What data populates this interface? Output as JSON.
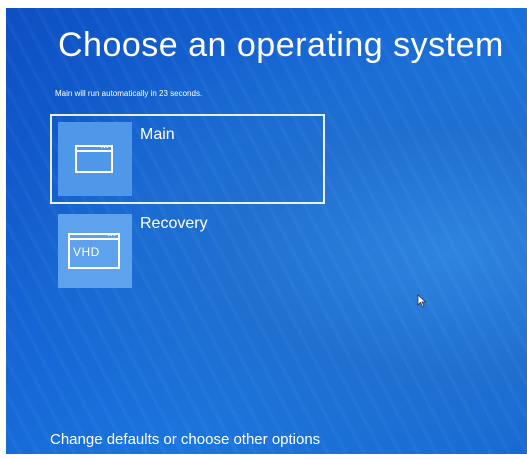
{
  "screen": {
    "title": "Choose an operating system",
    "countdown_text": "Main will run automatically in 23 seconds.",
    "footer_link": "Change defaults or choose other options"
  },
  "os_options": [
    {
      "name": "Main",
      "icon": "window-icon",
      "selected": true
    },
    {
      "name": "Recovery",
      "icon": "vhd-window-icon",
      "icon_text": "VHD",
      "selected": false
    }
  ],
  "colors": {
    "background": "#1565d4",
    "tile": "#4f97e8",
    "text": "#ffffff"
  }
}
